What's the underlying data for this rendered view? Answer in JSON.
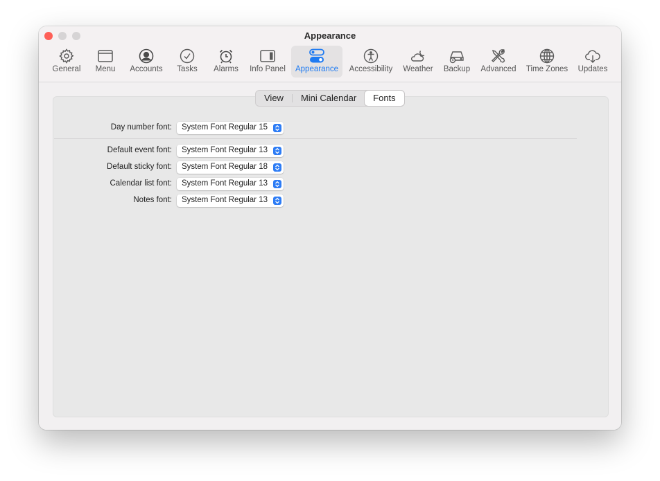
{
  "window": {
    "title": "Appearance"
  },
  "toolbar": {
    "items": [
      {
        "label": "General",
        "icon": "gear-icon"
      },
      {
        "label": "Menu",
        "icon": "menu-window-icon"
      },
      {
        "label": "Accounts",
        "icon": "person-circle-icon"
      },
      {
        "label": "Tasks",
        "icon": "checkmark-circle-icon"
      },
      {
        "label": "Alarms",
        "icon": "alarm-clock-icon"
      },
      {
        "label": "Info Panel",
        "icon": "sidebar-right-icon"
      },
      {
        "label": "Appearance",
        "icon": "toggles-icon",
        "active": true
      },
      {
        "label": "Accessibility",
        "icon": "accessibility-icon"
      },
      {
        "label": "Weather",
        "icon": "cloud-moon-icon"
      },
      {
        "label": "Backup",
        "icon": "external-drive-clock-icon"
      },
      {
        "label": "Advanced",
        "icon": "tools-icon"
      },
      {
        "label": "Time Zones",
        "icon": "globe-icon"
      },
      {
        "label": "Updates",
        "icon": "cloud-download-icon"
      }
    ]
  },
  "tabs": {
    "items": [
      {
        "label": "View"
      },
      {
        "label": "Mini Calendar"
      },
      {
        "label": "Fonts",
        "active": true
      }
    ]
  },
  "fonts": {
    "day_number": {
      "label": "Day number font:",
      "value": "System Font Regular 15"
    },
    "rows": [
      {
        "label": "Default event font:",
        "value": "System Font Regular 13"
      },
      {
        "label": "Default sticky font:",
        "value": "System Font Regular 18"
      },
      {
        "label": "Calendar list font:",
        "value": "System Font Regular 13"
      },
      {
        "label": "Notes font:",
        "value": "System Font Regular 13"
      }
    ]
  },
  "colors": {
    "accent": "#1f7bf2",
    "close_button": "#fe5f57"
  }
}
